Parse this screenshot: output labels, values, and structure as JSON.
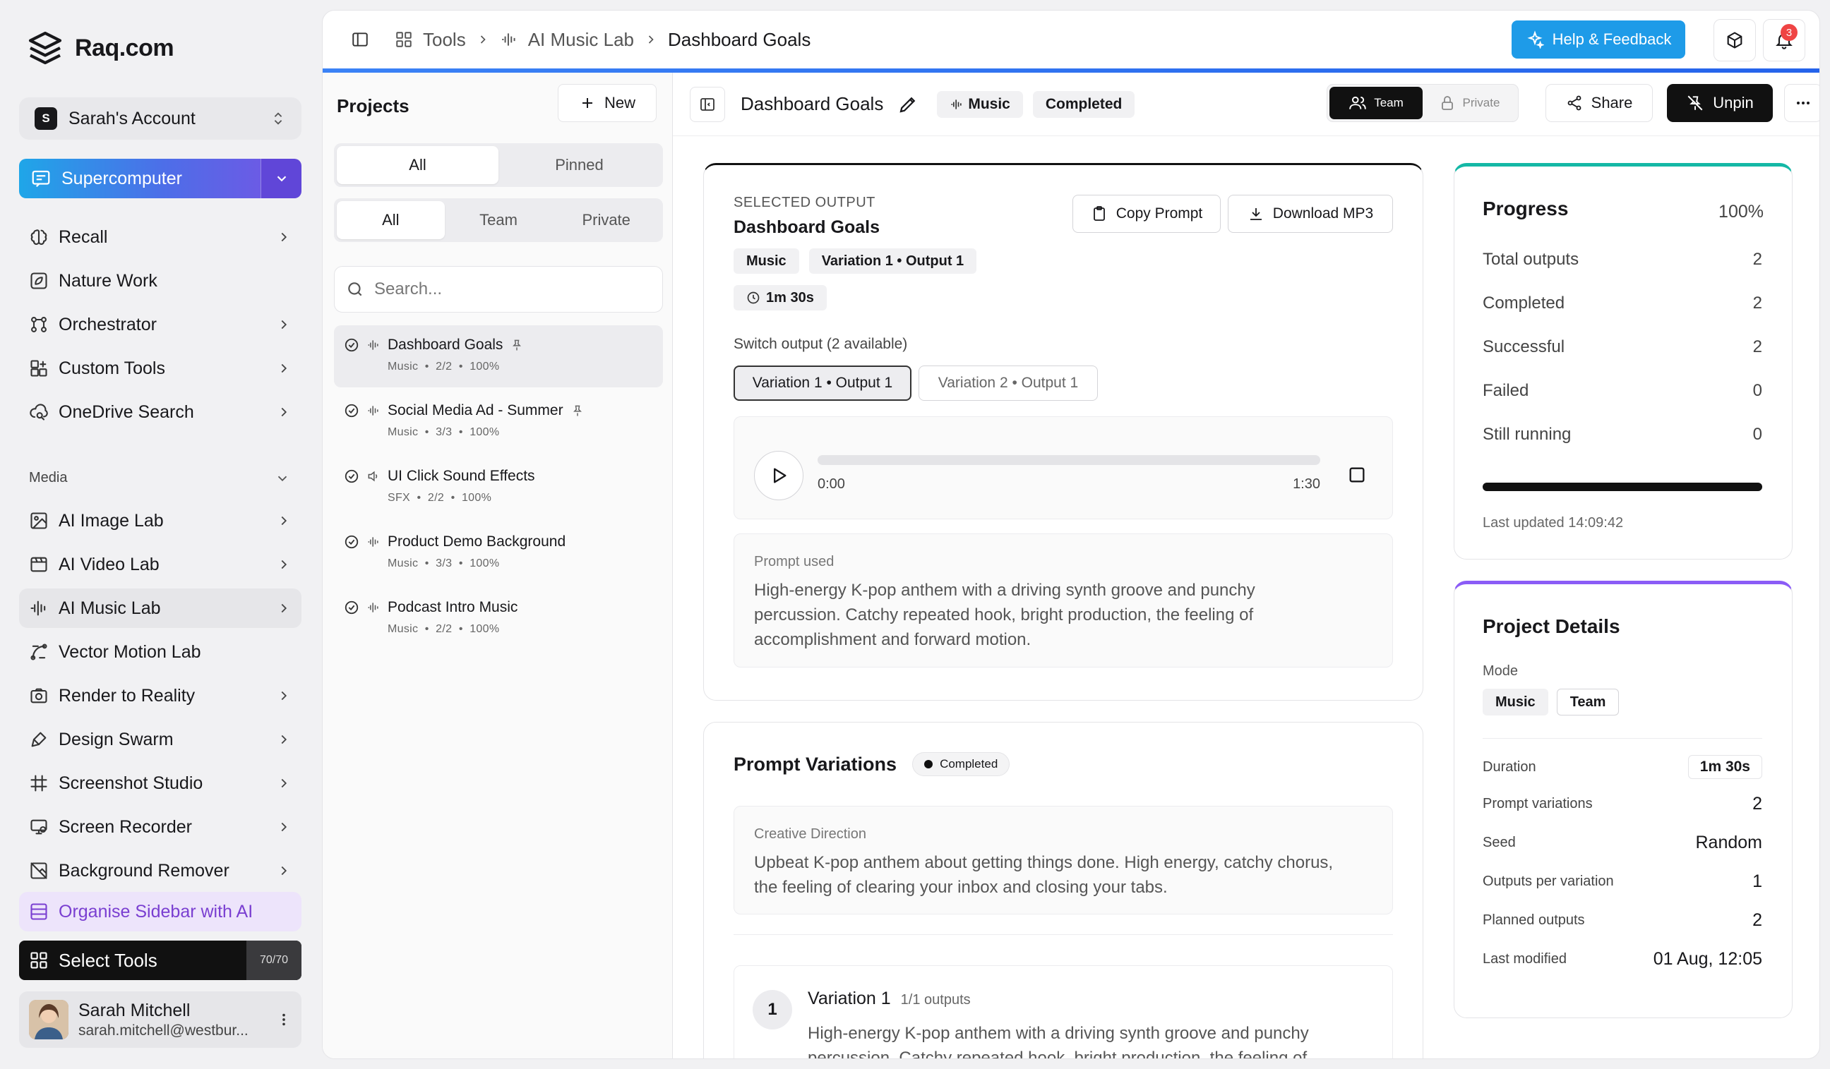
{
  "app": {
    "name": "Raq.com"
  },
  "sidebar": {
    "account": {
      "initial": "S",
      "name": "Sarah's Account"
    },
    "primary_tool": "Supercomputer",
    "items": [
      {
        "label": "Recall",
        "icon": "brain-icon",
        "chevron": true
      },
      {
        "label": "Nature Work",
        "icon": "image-leaf-icon",
        "chevron": false
      },
      {
        "label": "Orchestrator",
        "icon": "workflow-icon",
        "chevron": true
      },
      {
        "label": "Custom Tools",
        "icon": "blocks-icon",
        "chevron": true
      },
      {
        "label": "OneDrive Search",
        "icon": "cloud-search-icon",
        "chevron": true
      }
    ],
    "media_label": "Media",
    "media_items": [
      {
        "label": "AI Image Lab",
        "icon": "image-icon",
        "chevron": true
      },
      {
        "label": "AI Video Lab",
        "icon": "video-icon",
        "chevron": true
      },
      {
        "label": "AI Music Lab",
        "icon": "audio-wave-icon",
        "chevron": true,
        "active": true
      },
      {
        "label": "Vector Motion Lab",
        "icon": "vector-icon",
        "chevron": false
      },
      {
        "label": "Render to Reality",
        "icon": "camera-icon",
        "chevron": true
      },
      {
        "label": "Design Swarm",
        "icon": "brush-icon",
        "chevron": true
      },
      {
        "label": "Screenshot Studio",
        "icon": "hash-frame-icon",
        "chevron": true
      },
      {
        "label": "Screen Recorder",
        "icon": "monitor-icon",
        "chevron": true
      },
      {
        "label": "Background Remover",
        "icon": "image-off-icon",
        "chevron": true
      }
    ],
    "organise_label": "Organise Sidebar with AI",
    "select_tools": {
      "label": "Select Tools",
      "count": "70/70"
    },
    "user": {
      "name": "Sarah Mitchell",
      "email": "sarah.mitchell@westbur..."
    }
  },
  "topbar": {
    "breadcrumbs": [
      "Tools",
      "AI Music Lab",
      "Dashboard Goals"
    ],
    "help_label": "Help & Feedback",
    "notification_count": "3"
  },
  "projects": {
    "title": "Projects",
    "new_label": "New",
    "filter1": [
      "All",
      "Pinned"
    ],
    "filter2": [
      "All",
      "Team",
      "Private"
    ],
    "search_placeholder": "Search...",
    "items": [
      {
        "title": "Dashboard Goals",
        "type": "Music",
        "count": "2/2",
        "pct": "100%",
        "pinned": true
      },
      {
        "title": "Social Media Ad - Summer",
        "type": "Music",
        "count": "3/3",
        "pct": "100%",
        "pinned": true
      },
      {
        "title": "UI Click Sound Effects",
        "type": "SFX",
        "count": "2/2",
        "pct": "100%",
        "pinned": false
      },
      {
        "title": "Product Demo Background",
        "type": "Music",
        "count": "3/3",
        "pct": "100%",
        "pinned": false
      },
      {
        "title": "Podcast Intro Music",
        "type": "Music",
        "count": "2/2",
        "pct": "100%",
        "pinned": false
      }
    ]
  },
  "detail": {
    "title": "Dashboard Goals",
    "mode_chip": "Music",
    "status_chip": "Completed",
    "team_label": "Team",
    "private_label": "Private",
    "share_label": "Share",
    "unpin_label": "Unpin"
  },
  "output": {
    "section_label": "SELECTED OUTPUT",
    "title": "Dashboard Goals",
    "tags": [
      "Music",
      "Variation 1 • Output 1"
    ],
    "duration": "1m 30s",
    "copy_label": "Copy Prompt",
    "download_label": "Download MP3",
    "switch_label": "Switch output (2 available)",
    "variations": [
      "Variation 1 • Output 1",
      "Variation 2 • Output 1"
    ],
    "player": {
      "current": "0:00",
      "total": "1:30",
      "progress": 0
    },
    "prompt_label": "Prompt used",
    "prompt_text": "High-energy K-pop anthem with a driving synth groove and punchy percussion. Catchy repeated hook, bright production, the feeling of accomplishment and forward motion."
  },
  "variations_card": {
    "title": "Prompt Variations",
    "status": "Completed",
    "direction_label": "Creative Direction",
    "direction_text": "Upbeat K-pop anthem about getting things done. High energy, catchy chorus, the feeling of clearing your inbox and closing your tabs.",
    "v1": {
      "num": "1",
      "title": "Variation 1",
      "outputs": "1/1 outputs",
      "text": "High-energy K-pop anthem with a driving synth groove and punchy percussion. Catchy repeated hook, bright production, the feeling of"
    }
  },
  "progress": {
    "title": "Progress",
    "pct": "100%",
    "fill": 1.0,
    "rows": [
      {
        "label": "Total outputs",
        "value": "2"
      },
      {
        "label": "Completed",
        "value": "2"
      },
      {
        "label": "Successful",
        "value": "2"
      },
      {
        "label": "Failed",
        "value": "0"
      },
      {
        "label": "Still running",
        "value": "0"
      }
    ],
    "updated": "Last updated 14:09:42",
    "accent": "#14b8a6"
  },
  "project_details": {
    "title": "Project Details",
    "mode_label": "Mode",
    "mode_tags": [
      "Music",
      "Team"
    ],
    "rows": [
      {
        "label": "Duration",
        "value": "1m 30s"
      },
      {
        "label": "Prompt variations",
        "value": "2"
      },
      {
        "label": "Seed",
        "value": "Random"
      },
      {
        "label": "Outputs per variation",
        "value": "1"
      },
      {
        "label": "Planned outputs",
        "value": "2"
      },
      {
        "label": "Last modified",
        "value": "01 Aug, 12:05"
      }
    ],
    "accent": "#8b5cf6"
  }
}
